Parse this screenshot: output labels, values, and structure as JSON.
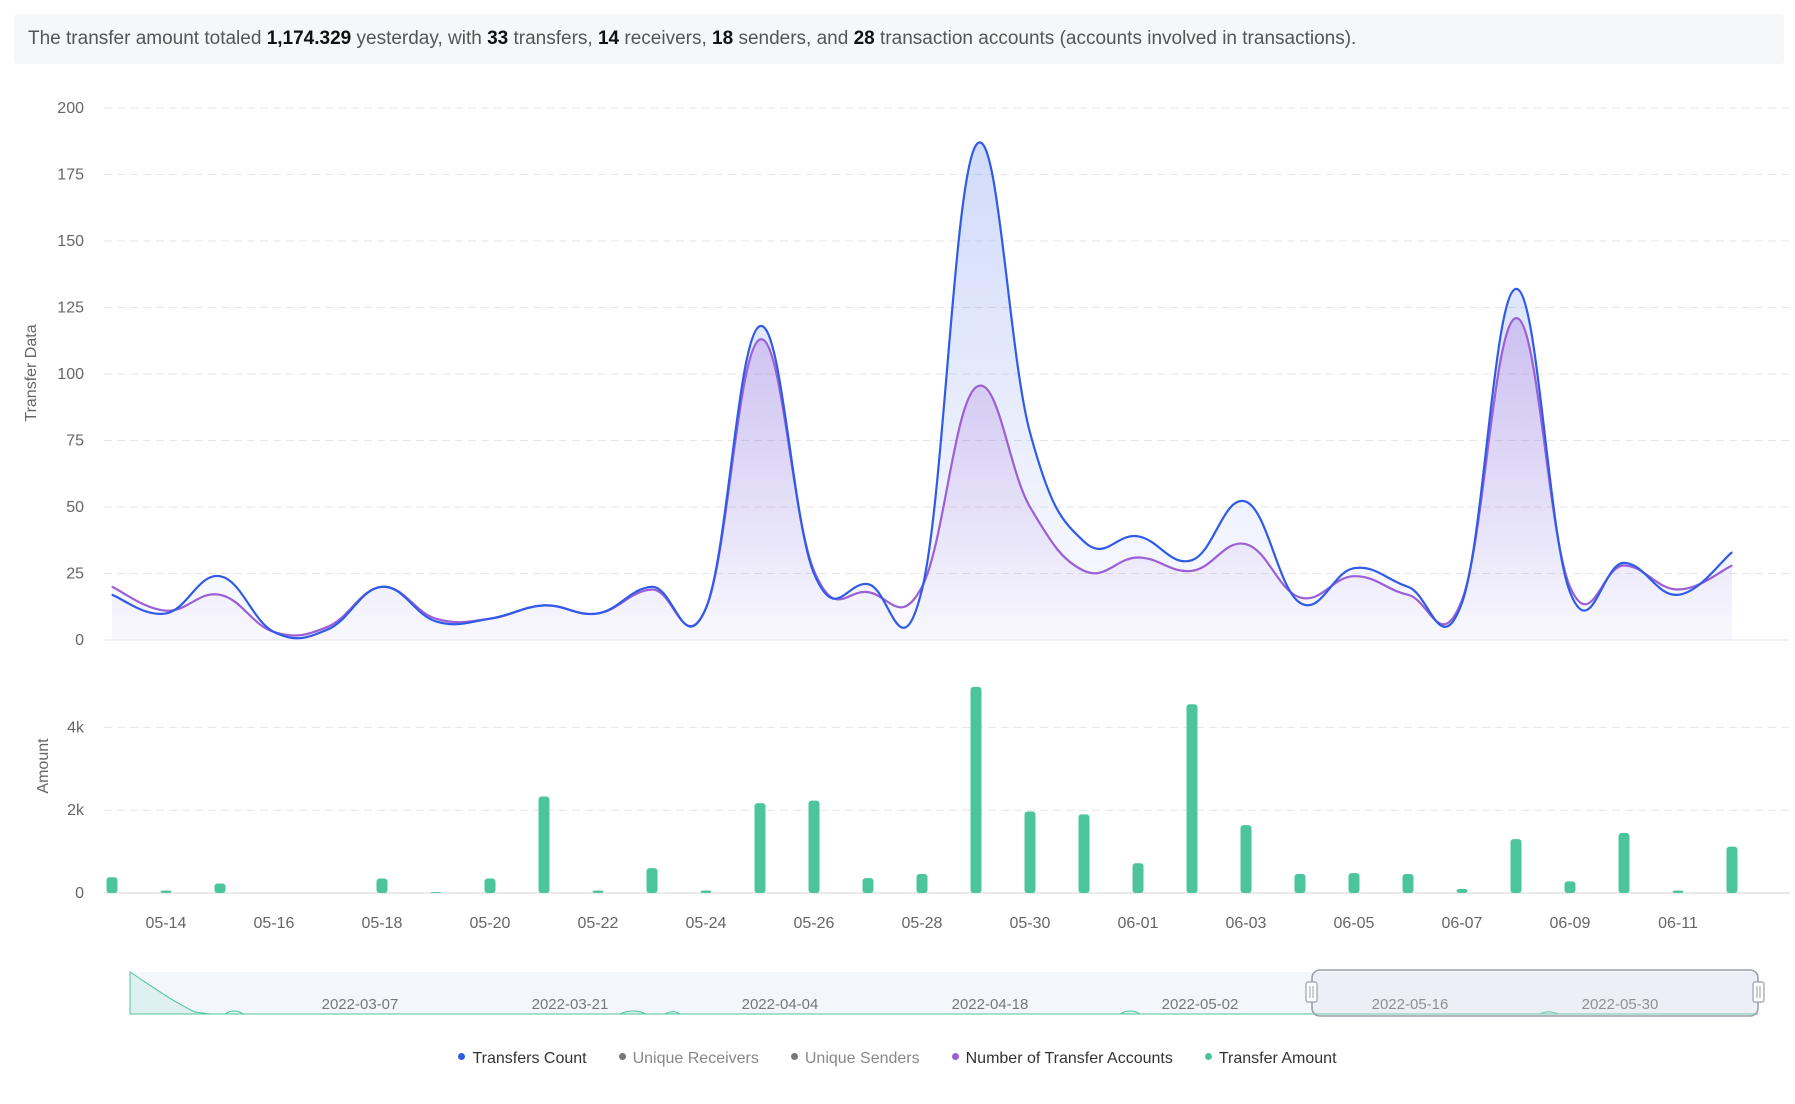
{
  "summary": {
    "p1": "The transfer amount totaled ",
    "amount": "1,174.329",
    "p2": " yesterday, with ",
    "transfers": "33",
    "p3": " transfers, ",
    "receivers": "14",
    "p4": " receivers, ",
    "senders": "18",
    "p5": " senders, and ",
    "accounts": "28",
    "p6": " transaction accounts (accounts involved in transactions)."
  },
  "legend": [
    {
      "label": "Transfers Count",
      "color": "#2f5be8",
      "active": true
    },
    {
      "label": "Unique Receivers",
      "color": "#777777",
      "active": false
    },
    {
      "label": "Unique Senders",
      "color": "#777777",
      "active": false
    },
    {
      "label": "Number of Transfer Accounts",
      "color": "#9b5fd6",
      "active": true
    },
    {
      "label": "Transfer Amount",
      "color": "#4cc49c",
      "active": true
    }
  ],
  "colors": {
    "transfers": "#2f5be8",
    "accounts": "#9b5fd6",
    "amount": "#4cc49c"
  },
  "chart_data": [
    {
      "type": "line",
      "ylabel": "Transfer Data",
      "ylim": [
        0,
        200
      ],
      "yticks": [
        "0",
        "25",
        "50",
        "75",
        "100",
        "125",
        "150",
        "175",
        "200"
      ],
      "x": [
        "05-13",
        "05-14",
        "05-15",
        "05-16",
        "05-17",
        "05-18",
        "05-19",
        "05-20",
        "05-21",
        "05-22",
        "05-23",
        "05-24",
        "05-25",
        "05-26",
        "05-27",
        "05-28",
        "05-29",
        "05-30",
        "05-31",
        "06-01",
        "06-02",
        "06-03",
        "06-04",
        "06-05",
        "06-06",
        "06-07",
        "06-08",
        "06-09",
        "06-10",
        "06-11",
        "06-12"
      ],
      "xticks": [
        "05-14",
        "05-16",
        "05-18",
        "05-20",
        "05-22",
        "05-24",
        "05-26",
        "05-28",
        "05-30",
        "06-01",
        "06-03",
        "06-05",
        "06-07",
        "06-09",
        "06-11"
      ],
      "series": [
        {
          "name": "Transfers Count",
          "values": [
            17,
            10,
            24,
            3,
            4,
            20,
            7,
            8,
            13,
            10,
            20,
            12,
            118,
            25,
            21,
            19,
            186,
            78,
            37,
            39,
            30,
            52,
            14,
            27,
            20,
            14,
            132,
            18,
            29,
            17,
            33
          ]
        },
        {
          "name": "Number of Transfer Accounts",
          "values": [
            20,
            11,
            17,
            3,
            5,
            20,
            8,
            8,
            13,
            10,
            19,
            12,
            113,
            26,
            18,
            20,
            95,
            50,
            26,
            31,
            26,
            36,
            16,
            24,
            17,
            15,
            121,
            20,
            28,
            19,
            28
          ]
        }
      ],
      "grid": true,
      "smooth": true
    },
    {
      "type": "bar",
      "ylabel": "Amount",
      "ylim": [
        0,
        5000
      ],
      "yticks": [
        "0",
        "2k",
        "4k"
      ],
      "categories": [
        "05-13",
        "05-14",
        "05-15",
        "05-16",
        "05-17",
        "05-18",
        "05-19",
        "05-20",
        "05-21",
        "05-22",
        "05-23",
        "05-24",
        "05-25",
        "05-26",
        "05-27",
        "05-28",
        "05-29",
        "05-30",
        "05-31",
        "06-01",
        "06-02",
        "06-03",
        "06-04",
        "06-05",
        "06-06",
        "06-07",
        "06-08",
        "06-09",
        "06-10",
        "06-11",
        "06-12"
      ],
      "series": [
        {
          "name": "Transfer Amount",
          "values": [
            380,
            60,
            230,
            0,
            0,
            350,
            20,
            350,
            2330,
            60,
            600,
            60,
            2170,
            2230,
            360,
            460,
            4980,
            1970,
            1900,
            720,
            4560,
            1640,
            460,
            480,
            460,
            100,
            1300,
            280,
            1450,
            60,
            1120
          ]
        }
      ],
      "grid": true
    }
  ],
  "slider": {
    "labels": [
      "2022-03-07",
      "2022-03-21",
      "2022-04-04",
      "2022-04-18",
      "2022-05-02",
      "2022-05-16",
      "2022-05-30"
    ],
    "selected": "05-13 to 06-12"
  }
}
